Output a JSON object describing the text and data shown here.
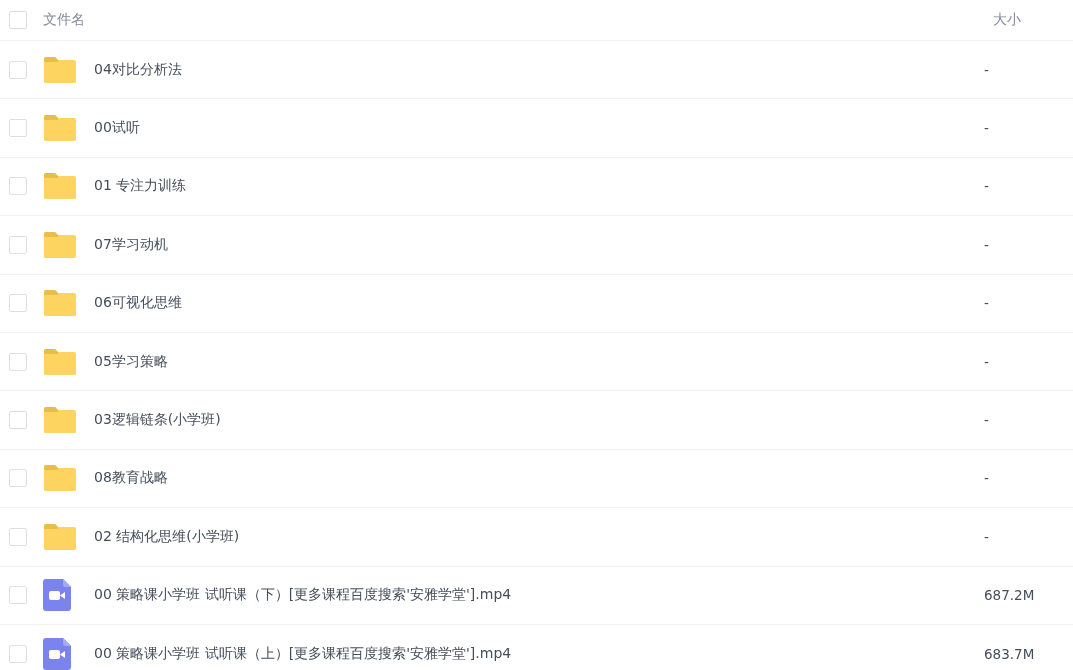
{
  "header": {
    "checked": false,
    "name_label": "文件名",
    "size_label": "大小"
  },
  "files": [
    {
      "kind": "folder",
      "name": "04对比分析法",
      "size": "-",
      "checked": false
    },
    {
      "kind": "folder",
      "name": "00试听",
      "size": "-",
      "checked": false
    },
    {
      "kind": "folder",
      "name": "01 专注力训练",
      "size": "-",
      "checked": false
    },
    {
      "kind": "folder",
      "name": "07学习动机",
      "size": "-",
      "checked": false
    },
    {
      "kind": "folder",
      "name": "06可视化思维",
      "size": "-",
      "checked": false
    },
    {
      "kind": "folder",
      "name": "05学习策略",
      "size": "-",
      "checked": false
    },
    {
      "kind": "folder",
      "name": "03逻辑链条(小学班)",
      "size": "-",
      "checked": false
    },
    {
      "kind": "folder",
      "name": "08教育战略",
      "size": "-",
      "checked": false
    },
    {
      "kind": "folder",
      "name": "02 结构化思维(小学班)",
      "size": "-",
      "checked": false
    },
    {
      "kind": "video",
      "name": "00 策略课小学班 试听课（下）[更多课程百度搜索'安雅学堂'].mp4",
      "size": "687.2M",
      "checked": false
    },
    {
      "kind": "video",
      "name": "00 策略课小学班 试听课（上）[更多课程百度搜索'安雅学堂'].mp4",
      "size": "683.7M",
      "checked": false
    }
  ]
}
